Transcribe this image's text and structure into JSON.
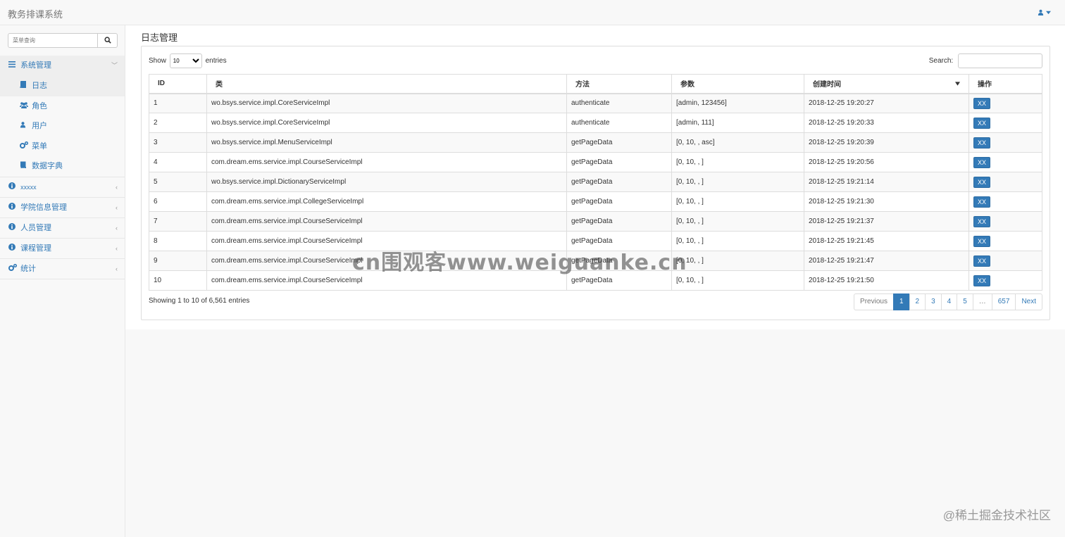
{
  "app": {
    "title": "教务排课系统"
  },
  "sidebar": {
    "search_placeholder": "菜单查询",
    "menu": [
      {
        "label": "系统管理",
        "icon": "bars-icon",
        "open": true,
        "children": [
          {
            "label": "日志",
            "icon": "book-icon",
            "active": true
          },
          {
            "label": "角色",
            "icon": "users-icon"
          },
          {
            "label": "用户",
            "icon": "user-icon"
          },
          {
            "label": "菜单",
            "icon": "cogs-icon"
          },
          {
            "label": "数据字典",
            "icon": "book-icon"
          }
        ]
      },
      {
        "label": "xxxxx",
        "icon": "info-circle-icon"
      },
      {
        "label": "学院信息管理",
        "icon": "info-circle-icon"
      },
      {
        "label": "人员管理",
        "icon": "info-circle-icon"
      },
      {
        "label": "课程管理",
        "icon": "info-circle-icon"
      },
      {
        "label": "统计",
        "icon": "cogs-icon"
      }
    ]
  },
  "page": {
    "title": "日志管理"
  },
  "table_controls": {
    "show_label": "Show",
    "length_value": "10",
    "entries_label": "entries",
    "search_label": "Search:"
  },
  "table": {
    "headers": [
      "ID",
      "类",
      "方法",
      "参数",
      "创建时间",
      "操作"
    ],
    "action_label": "XX",
    "rows": [
      [
        "1",
        "wo.bsys.service.impl.CoreServiceImpl",
        "authenticate",
        "[admin, 123456]",
        "2018-12-25 19:20:27"
      ],
      [
        "2",
        "wo.bsys.service.impl.CoreServiceImpl",
        "authenticate",
        "[admin, 111]",
        "2018-12-25 19:20:33"
      ],
      [
        "3",
        "wo.bsys.service.impl.MenuServiceImpl",
        "getPageData",
        "[0, 10, , asc]",
        "2018-12-25 19:20:39"
      ],
      [
        "4",
        "com.dream.ems.service.impl.CourseServiceImpl",
        "getPageData",
        "[0, 10, , ]",
        "2018-12-25 19:20:56"
      ],
      [
        "5",
        "wo.bsys.service.impl.DictionaryServiceImpl",
        "getPageData",
        "[0, 10, , ]",
        "2018-12-25 19:21:14"
      ],
      [
        "6",
        "com.dream.ems.service.impl.CollegeServiceImpl",
        "getPageData",
        "[0, 10, , ]",
        "2018-12-25 19:21:30"
      ],
      [
        "7",
        "com.dream.ems.service.impl.CourseServiceImpl",
        "getPageData",
        "[0, 10, , ]",
        "2018-12-25 19:21:37"
      ],
      [
        "8",
        "com.dream.ems.service.impl.CourseServiceImpl",
        "getPageData",
        "[0, 10, , ]",
        "2018-12-25 19:21:45"
      ],
      [
        "9",
        "com.dream.ems.service.impl.CourseServiceImpl",
        "getPageData",
        "[0, 10, , ]",
        "2018-12-25 19:21:47"
      ],
      [
        "10",
        "com.dream.ems.service.impl.CourseServiceImpl",
        "getPageData",
        "[0, 10, , ]",
        "2018-12-25 19:21:50"
      ]
    ]
  },
  "footer": {
    "info": "Showing 1 to 10 of 6,561 entries",
    "pages": [
      "Previous",
      "1",
      "2",
      "3",
      "4",
      "5",
      "…",
      "657",
      "Next"
    ],
    "active_page": "1"
  },
  "watermark": "cn围观客www.weiguanke.cn",
  "corner_mark": "@稀土掘金技术社区",
  "colors": {
    "accent": "#337ab7",
    "border": "#dddddd",
    "stripe": "#f9f9f9"
  }
}
